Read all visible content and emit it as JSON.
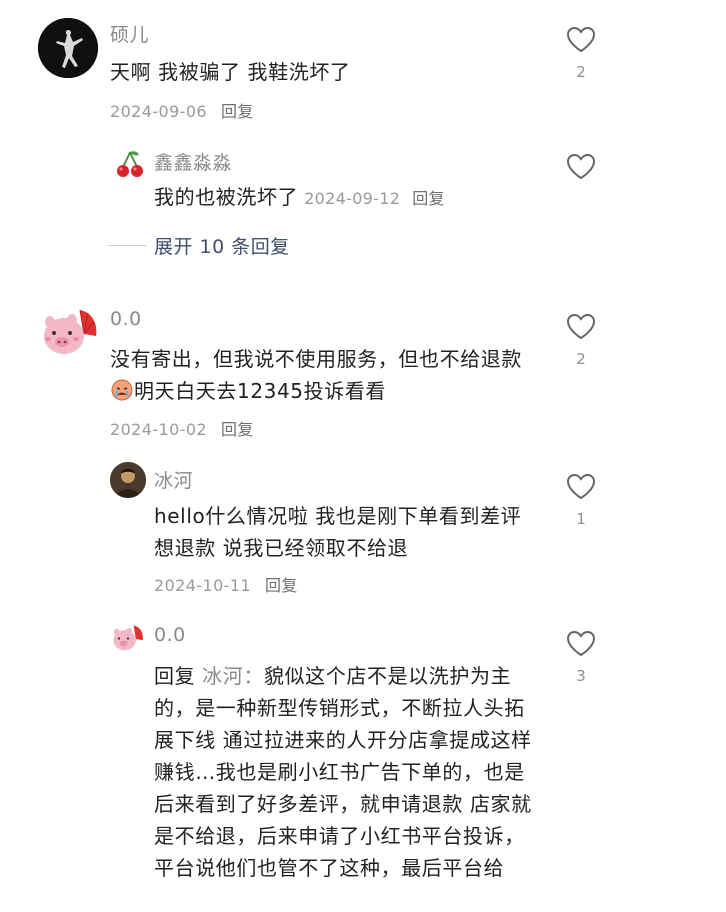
{
  "comments": [
    {
      "username": "硕儿",
      "text": "天啊 我被骗了 我鞋洗坏了",
      "date": "2024-09-06",
      "reply_label": "回复",
      "like_count": "2",
      "avatar_icon": "dancer-silhouette-avatar",
      "reply": {
        "username": "鑫鑫淼淼",
        "text": "我的也被洗坏了",
        "date": "2024-09-12",
        "reply_label": "回复",
        "like_count": "",
        "avatar_icon": "cherry-avatar"
      },
      "expand_label": "展开 10 条回复"
    },
    {
      "username": "0.0",
      "text": "没有寄出，但我说不使用服务，但也不给退款",
      "text_after_emoji": "明天白天去12345投诉看看",
      "date": "2024-10-02",
      "reply_label": "回复",
      "like_count": "2",
      "avatar_icon": "pink-pig-fan-avatar",
      "emoji_icon": "crying-face-emoji",
      "replies": [
        {
          "username": "冰河",
          "text": "hello什么情况啦 我也是刚下单看到差评想退款 说我已经领取不给退",
          "date": "2024-10-11",
          "reply_label": "回复",
          "like_count": "1",
          "avatar_icon": "photo-avatar"
        },
        {
          "username": "0.0",
          "reply_prefix": "回复",
          "reply_target": "冰河：",
          "text": "貌似这个店不是以洗护为主的，是一种新型传销形式，不断拉人头拓展下线 通过拉进来的人开分店拿提成这样赚钱…我也是刷小红书广告下单的，也是后来看到了好多差评，就申请退款 店家就是不给退，后来申请了小红书平台投诉，平台说他们也管不了这种，最后平台给",
          "like_count": "3",
          "avatar_icon": "pink-pig-fan-avatar"
        }
      ]
    }
  ],
  "colors": {
    "username": "#8a8a8a",
    "text": "#222222",
    "meta": "#9a9a9a",
    "expand": "#3f4f6b",
    "heart_stroke": "#666666"
  }
}
